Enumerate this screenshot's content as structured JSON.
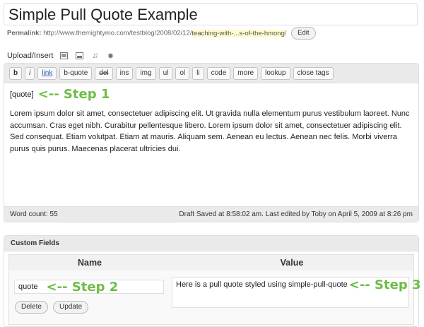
{
  "post": {
    "title": "Simple Pull Quote Example",
    "permalink_label": "Permalink:",
    "permalink_base": "http://www.themightymo.com/testblog/2008/02/12/",
    "permalink_slug": "teaching-with-...s-of-the-hmong",
    "permalink_trailing": "/",
    "edit_label": "Edit"
  },
  "upload": {
    "label": "Upload/Insert",
    "icons": [
      "image-icon",
      "video-icon",
      "audio-icon",
      "media-icon"
    ]
  },
  "toolbar": {
    "buttons": [
      "b",
      "i",
      "link",
      "b-quote",
      "del",
      "ins",
      "img",
      "ul",
      "ol",
      "li",
      "code",
      "more",
      "lookup",
      "close tags"
    ]
  },
  "editor": {
    "shortcode": "[quote]",
    "step1": "<-- Step 1",
    "body_text": "Lorem ipsum dolor sit amet, consectetuer adipiscing elit. Ut gravida nulla elementum purus vestibulum laoreet. Nunc accumsan. Cras eget nibh. Curabitur pellentesque libero. Lorem ipsum dolor sit amet, consectetuer adipiscing elit. Sed consequat. Etiam volutpat. Etiam at mauris. Aliquam sem. Aenean eu lectus. Aenean nec felis. Morbi viverra purus quis purus. Maecenas placerat ultricies dui."
  },
  "status": {
    "word_count": "Word count: 55",
    "draft_saved": "Draft Saved at 8:58:02 am. Last edited by Toby on April 5, 2009 at 8:26 pm"
  },
  "custom_fields": {
    "header": "Custom Fields",
    "name_header": "Name",
    "value_header": "Value",
    "name_value": "quote",
    "step2": "<-- Step 2",
    "value_value": "Here is a pull quote styled using simple-pull-quote",
    "step3": "<-- Step 3",
    "delete_label": "Delete",
    "update_label": "Update"
  },
  "colors": {
    "step_green": "#6cbe45",
    "slug_highlight": "#fffbcc"
  }
}
